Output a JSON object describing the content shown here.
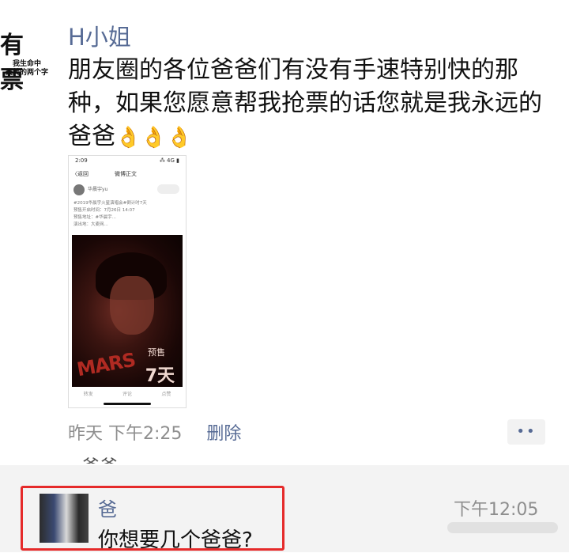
{
  "avatar": {
    "big_text": "有 票",
    "sub_line1": "我生命中",
    "sub_line2": "最美的两个字"
  },
  "post": {
    "author": "H小姐",
    "text": "朋友圈的各位爸爸们有没有手速特别快的那种，如果您愿意帮我抢票的话您就是我永远的爸爸",
    "emoji": "👌👌👌",
    "image": {
      "status_time": "2:09",
      "status_right": "⁂ 4G ▮",
      "back": "〈返回",
      "title": "微博正文",
      "username": "华晨宇yu",
      "body_lines": [
        "#2019华晨宇火星演唱会#倒计时7天",
        "预售开启时间：7月26日 14:07",
        "预售地址：#华晨宇...",
        "演出地：大麦网..."
      ],
      "poster_word": "MARS",
      "poster_yure": "预售",
      "poster_count": "7天",
      "actions": [
        "转发",
        "评论",
        "点赞"
      ]
    },
    "time": "昨天 下午2:25",
    "delete_label": "删除",
    "more_label": "••"
  },
  "hidden_comment": "爸爸 ...",
  "comment": {
    "name": "爸",
    "time": "下午12:05",
    "text": "你想要几个爸爸?"
  }
}
